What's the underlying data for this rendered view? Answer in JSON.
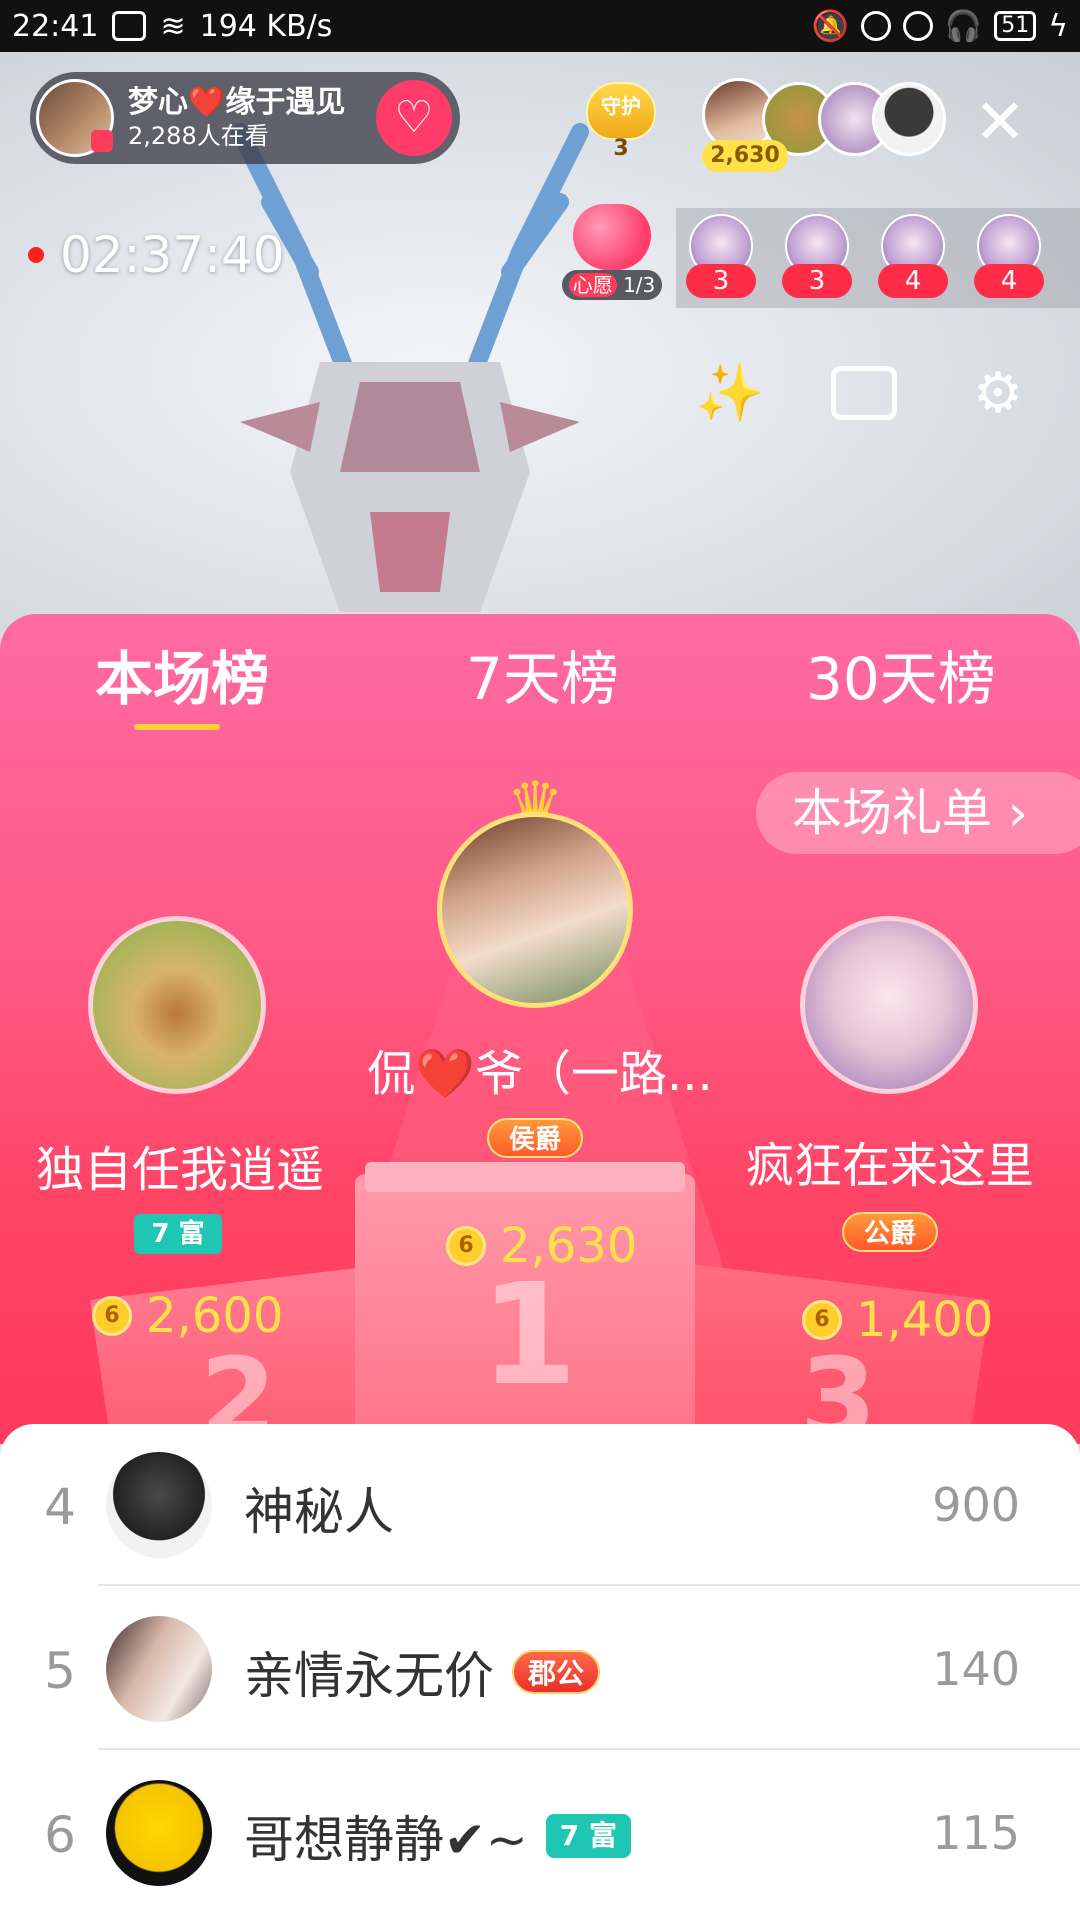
{
  "status_bar": {
    "time": "22:41",
    "network_speed": "194 KB/s",
    "battery": "51"
  },
  "live": {
    "host_name": "梦心❤️缘于遇见",
    "viewers": "2,288人在看",
    "guard_label": "守护",
    "guard_count": "3",
    "top_viewer_coins": "2,630",
    "timer": "02:37:40",
    "wish_label": "心愿",
    "wish_progress": "1/3",
    "fan_counts": [
      "3",
      "3",
      "4",
      "4"
    ]
  },
  "ranking": {
    "tabs": [
      "本场榜",
      "7天榜",
      "30天榜"
    ],
    "active_tab": 0,
    "gift_list_button": "本场礼单 ›",
    "podium": [
      {
        "rank": "1",
        "name": "侃❤️爷（一路...",
        "badge": "侯爵",
        "score": "2,630"
      },
      {
        "rank": "2",
        "name": "独自任我逍遥",
        "badge": "7 富",
        "score": "2,600"
      },
      {
        "rank": "3",
        "name": "疯狂在来这里",
        "badge": "公爵",
        "score": "1,400"
      }
    ],
    "list": [
      {
        "rank": "4",
        "name": "神秘人",
        "badge": "",
        "score": "900"
      },
      {
        "rank": "5",
        "name": "亲情永无价",
        "badge": "郡公",
        "score": "140"
      },
      {
        "rank": "6",
        "name": "哥想静静✔~",
        "badge": "7 富",
        "score": "115"
      }
    ],
    "coin_symbol": "6"
  },
  "colors": {
    "panel_pink": "#ff5a86",
    "score_yellow": "#ffe14a",
    "teal_badge": "#1fc6b3"
  }
}
